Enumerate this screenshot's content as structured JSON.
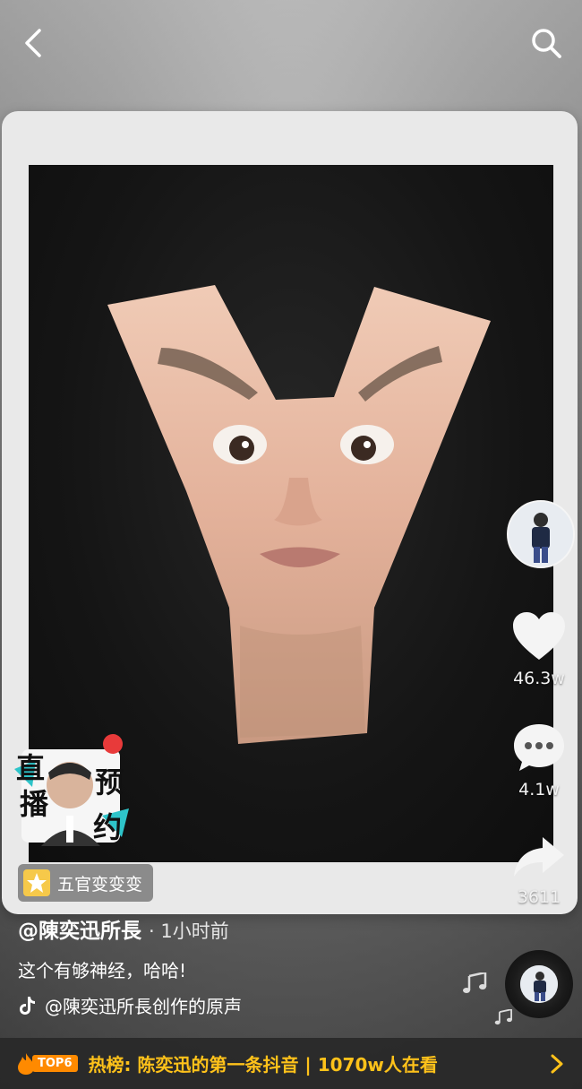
{
  "effect": {
    "label": "五官变变变"
  },
  "author": {
    "handle": "@陳奕迅所長",
    "time": "· 1小时前"
  },
  "caption": "这个有够神经，哈哈!",
  "music": {
    "label": "@陳奕迅所長创作的原声"
  },
  "live_badge": {
    "chars": [
      "直",
      "播",
      "预",
      "约"
    ]
  },
  "actions": {
    "like_count": "46.3w",
    "comment_count": "4.1w",
    "share_count": "3611"
  },
  "hot_bar": {
    "rank": "TOP6",
    "text": "热榜: 陈奕迅的第一条抖音 | 1070w人在看"
  },
  "colors": {
    "hot_text": "#ffc21a",
    "rank_badge": "#ff8a00"
  }
}
